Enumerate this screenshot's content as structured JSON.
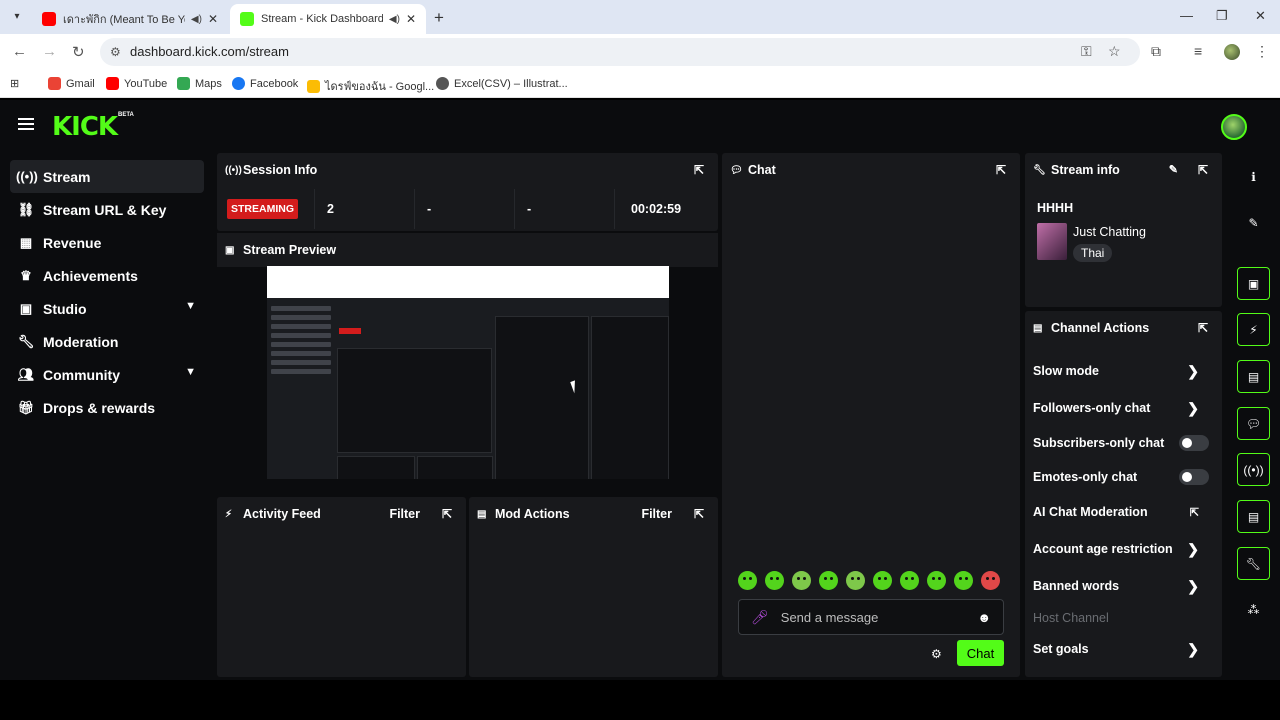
{
  "browser": {
    "tabs": [
      {
        "title": "เดาะพักิก (Meant To Be Your",
        "favicon_color": "#ff0000"
      },
      {
        "title": "Stream - Kick Dashboard",
        "favicon_color": "#53fc18"
      }
    ],
    "url": "dashboard.kick.com/stream",
    "bookmarks": [
      {
        "label": "Gmail",
        "color": "#ea4335"
      },
      {
        "label": "YouTube",
        "color": "#ff0000"
      },
      {
        "label": "Maps",
        "color": "#34a853"
      },
      {
        "label": "Facebook",
        "color": "#1877f2"
      },
      {
        "label": "ไดรฟ์ของฉัน - Googl...",
        "color": "#fbbc04"
      },
      {
        "label": "Excel(CSV) – Illustrat...",
        "color": "#555555"
      }
    ]
  },
  "header": {
    "logo": "KICK",
    "badge": "BETA"
  },
  "sidebar": {
    "items": [
      {
        "label": "Stream",
        "icon": "broadcast-icon"
      },
      {
        "label": "Stream URL & Key",
        "icon": "link-icon"
      },
      {
        "label": "Revenue",
        "icon": "chart-icon"
      },
      {
        "label": "Achievements",
        "icon": "trophy-icon"
      },
      {
        "label": "Studio",
        "icon": "studio-icon"
      },
      {
        "label": "Moderation",
        "icon": "wrench-icon"
      },
      {
        "label": "Community",
        "icon": "people-icon"
      },
      {
        "label": "Drops & rewards",
        "icon": "gift-icon"
      }
    ]
  },
  "session": {
    "title": "Session Info",
    "status": "STREAMING",
    "viewers": "2",
    "stat2": "-",
    "stat3": "-",
    "duration": "00:02:59"
  },
  "preview": {
    "title": "Stream Preview"
  },
  "activity": {
    "title": "Activity Feed",
    "filter": "Filter"
  },
  "mod_actions": {
    "title": "Mod Actions",
    "filter": "Filter"
  },
  "chat": {
    "title": "Chat",
    "placeholder": "Send a message",
    "send_label": "Chat"
  },
  "stream_info": {
    "title": "Stream info",
    "stream_title": "HHHH",
    "category": "Just Chatting",
    "language": "Thai"
  },
  "channel_actions": {
    "title": "Channel Actions",
    "items": [
      {
        "label": "Slow mode",
        "control": "chevron"
      },
      {
        "label": "Followers-only chat",
        "control": "chevron"
      },
      {
        "label": "Subscribers-only chat",
        "control": "toggle"
      },
      {
        "label": "Emotes-only chat",
        "control": "toggle"
      },
      {
        "label": "AI Chat Moderation",
        "control": "external"
      },
      {
        "label": "Account age restriction",
        "control": "chevron"
      },
      {
        "label": "Banned words",
        "control": "chevron"
      },
      {
        "label": "Host Channel",
        "control": "none"
      },
      {
        "label": "Set goals",
        "control": "chevron"
      }
    ]
  },
  "colors": {
    "accent": "#53fc18",
    "panel": "#18191c",
    "streaming": "#d31c1c"
  }
}
